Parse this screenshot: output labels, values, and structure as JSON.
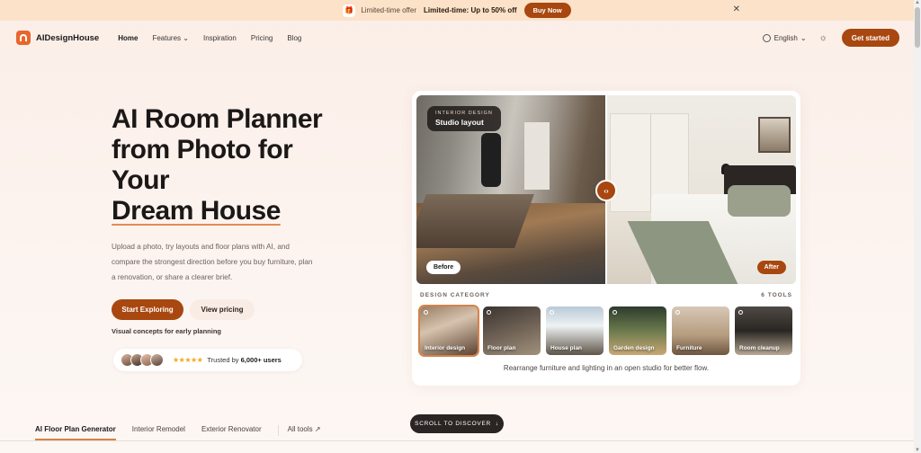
{
  "promo": {
    "tag": "Limited-time offer",
    "headline": "Limited-time: Up to 50% off",
    "button": "Buy Now",
    "close": "✕"
  },
  "nav": {
    "logo": "AIDesignHouse",
    "links": [
      "Home",
      "Features",
      "Inspiration",
      "Pricing",
      "Blog"
    ],
    "language": "English",
    "cta": "Get started"
  },
  "hero": {
    "title_lines": [
      "AI Room Planner",
      "from Photo for",
      "Your"
    ],
    "title_highlight": "Dream House",
    "description": "Upload a photo, try layouts and floor plans with AI, and compare the strongest direction before you buy furniture, plan a renovation, or share a clearer brief.",
    "primary_button": "Start Exploring",
    "secondary_button": "View pricing",
    "note": "Visual concepts for early planning",
    "trust_prefix": "Trusted by",
    "trust_count": "6,000+ users",
    "stars": "★★★★★"
  },
  "preview": {
    "badge_small": "INTERIOR DESIGN",
    "badge_big": "Studio layout",
    "before": "Before",
    "after": "After",
    "category_heading": "DESIGN CATEGORY",
    "tool_count": "6 TOOLS",
    "categories": [
      "Interior design",
      "Floor plan",
      "House plan",
      "Garden design",
      "Furniture",
      "Room cleanup"
    ],
    "caption": "Rearrange furniture and lighting in an open studio for better flow."
  },
  "tabs": [
    "AI Floor Plan Generator",
    "Interior Remodel",
    "Exterior Renovator",
    "All tools ↗"
  ],
  "scroll_hint": "SCROLL TO DISCOVER"
}
